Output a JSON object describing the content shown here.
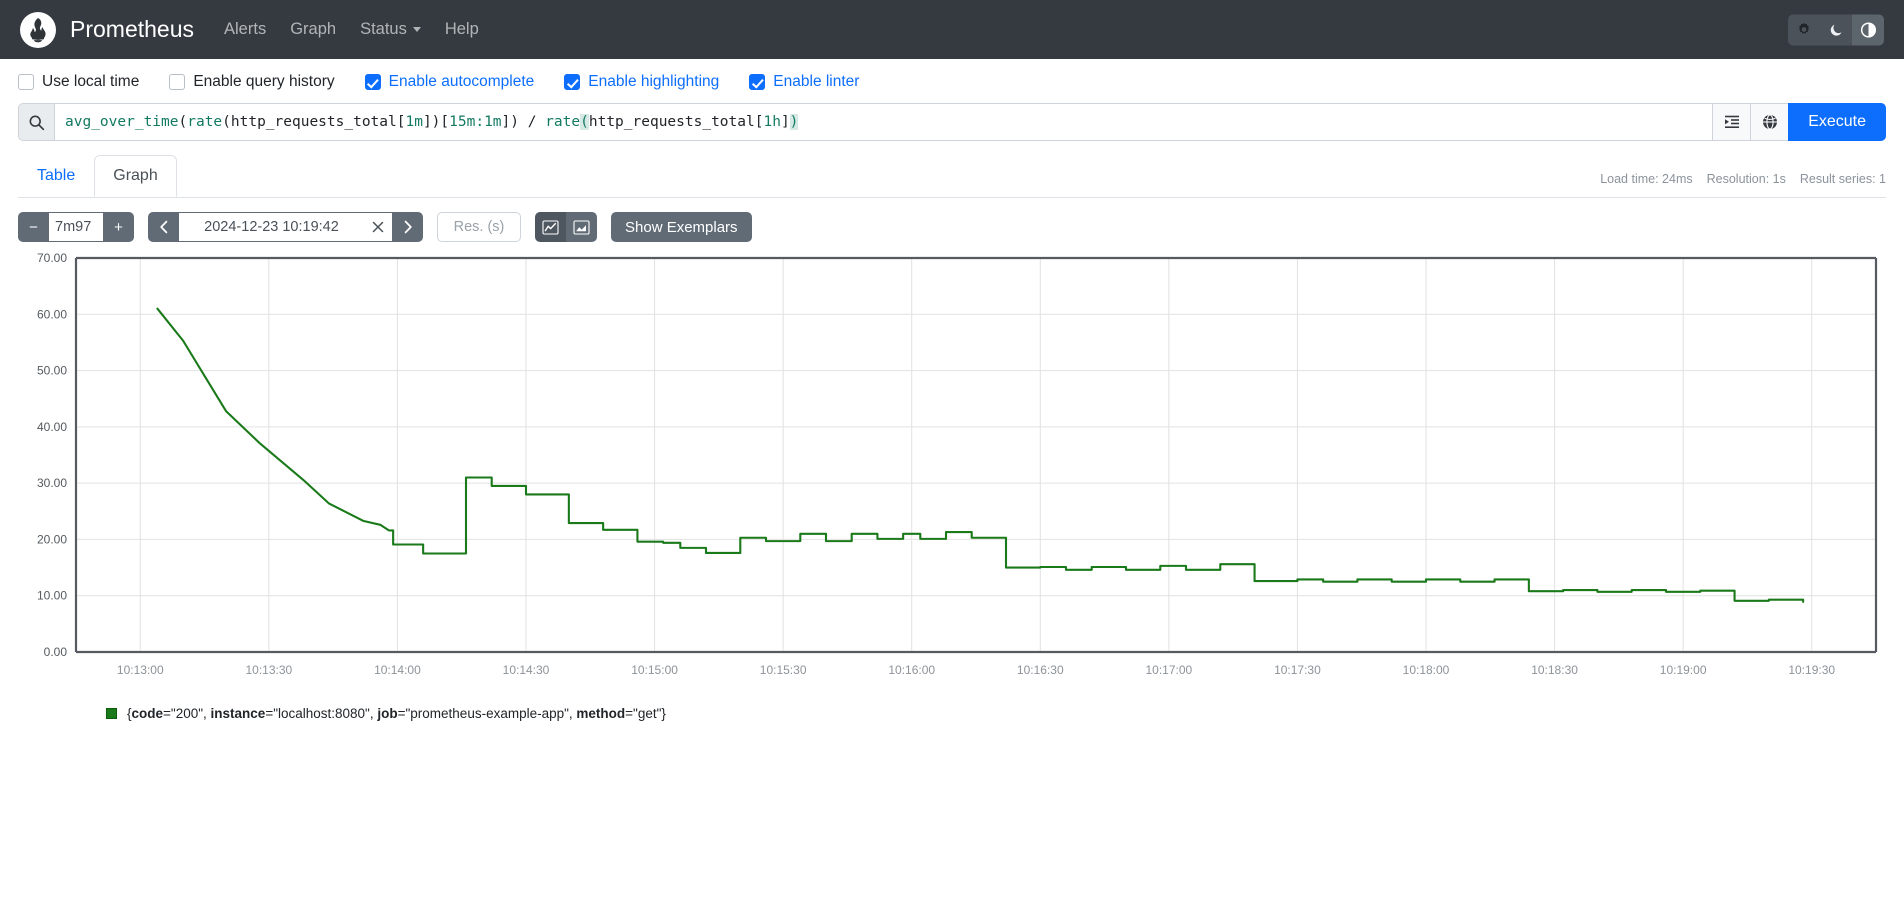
{
  "navbar": {
    "brand": "Prometheus",
    "logo_icon": "prometheus-torch-icon",
    "links": [
      {
        "label": "Alerts",
        "icon": ""
      },
      {
        "label": "Graph",
        "icon": ""
      },
      {
        "label": "Status",
        "icon": "chevron-down-icon",
        "has_caret": true
      },
      {
        "label": "Help",
        "icon": ""
      }
    ],
    "theme_buttons": [
      {
        "name": "light-theme-button",
        "icon": "sun-icon",
        "active": false
      },
      {
        "name": "dark-theme-button",
        "icon": "moon-icon",
        "active": false
      },
      {
        "name": "auto-theme-button",
        "icon": "half-circle-icon",
        "active": true
      }
    ]
  },
  "options": [
    {
      "label": "Use local time",
      "checked": false,
      "name": "use-local-time"
    },
    {
      "label": "Enable query history",
      "checked": false,
      "name": "enable-query-history"
    },
    {
      "label": "Enable autocomplete",
      "checked": true,
      "name": "enable-autocomplete"
    },
    {
      "label": "Enable highlighting",
      "checked": true,
      "name": "enable-highlighting"
    },
    {
      "label": "Enable linter",
      "checked": true,
      "name": "enable-linter"
    }
  ],
  "query": {
    "search_icon": "search-icon",
    "expression": "avg_over_time(rate(http_requests_total[1m])[15m:1m]) / rate(http_requests_total[1h])",
    "tokens": [
      {
        "text": "avg_over_time",
        "style": "fn"
      },
      {
        "text": "(",
        "style": "plain"
      },
      {
        "text": "rate",
        "style": "fn"
      },
      {
        "text": "(http_requests_total[",
        "style": "plain"
      },
      {
        "text": "1m",
        "style": "dur"
      },
      {
        "text": "])[",
        "style": "plain"
      },
      {
        "text": "15m:1m",
        "style": "dur"
      },
      {
        "text": "]) / ",
        "style": "plain"
      },
      {
        "text": "rate",
        "style": "fn"
      },
      {
        "text": "(",
        "style": "match"
      },
      {
        "text": "http_requests_total[",
        "style": "plain"
      },
      {
        "text": "1h",
        "style": "dur"
      },
      {
        "text": "]",
        "style": "plain"
      },
      {
        "text": ")",
        "style": "match"
      }
    ],
    "format_icon": "format-expression-icon",
    "metrics_explorer_icon": "globe-icon",
    "execute_label": "Execute"
  },
  "tabs": [
    {
      "label": "Table",
      "active": false,
      "name": "tab-table"
    },
    {
      "label": "Graph",
      "active": true,
      "name": "tab-graph"
    }
  ],
  "meta": {
    "load_time": "Load time: 24ms",
    "resolution": "Resolution: 1s",
    "result_series": "Result series: 1"
  },
  "controls": {
    "range_decrease": "−",
    "range_value": "7m97",
    "range_increase": "+",
    "time_prev": "‹",
    "time_value": "2024-12-23 10:19:42",
    "time_clear": "✕",
    "time_next": "›",
    "resolution_placeholder": "Res. (s)",
    "resolution_value": "",
    "chart_type_line_icon": "line-chart-icon",
    "chart_type_stacked_icon": "area-chart-icon",
    "chart_type_selected": "line",
    "show_exemplars_label": "Show Exemplars"
  },
  "legend": {
    "color": "#1a7a1a",
    "series_label": "{code=\"200\", instance=\"localhost:8080\", job=\"prometheus-example-app\", method=\"get\"}",
    "parts": [
      {
        "text": "{",
        "bold": false
      },
      {
        "text": "code",
        "bold": true
      },
      {
        "text": "=\"200\", ",
        "bold": false
      },
      {
        "text": "instance",
        "bold": true
      },
      {
        "text": "=\"localhost:8080\", ",
        "bold": false
      },
      {
        "text": "job",
        "bold": true
      },
      {
        "text": "=\"prometheus-example-app\", ",
        "bold": false
      },
      {
        "text": "method",
        "bold": true
      },
      {
        "text": "=\"get\"}",
        "bold": false
      }
    ]
  },
  "chart_data": {
    "type": "line",
    "title": "",
    "xlabel": "",
    "ylabel": "",
    "ylim": [
      0,
      70
    ],
    "yticks": [
      "0.00",
      "10.00",
      "20.00",
      "30.00",
      "40.00",
      "50.00",
      "60.00",
      "70.00"
    ],
    "ytick_values": [
      0,
      10,
      20,
      30,
      40,
      50,
      60,
      70
    ],
    "xticks": [
      "10:13:00",
      "10:13:30",
      "10:14:00",
      "10:14:30",
      "10:15:00",
      "10:15:30",
      "10:16:00",
      "10:16:30",
      "10:17:00",
      "10:17:30",
      "10:18:00",
      "10:18:30",
      "10:19:00",
      "10:19:30"
    ],
    "xtick_seconds": [
      780,
      810,
      840,
      870,
      900,
      930,
      960,
      990,
      1020,
      1050,
      1080,
      1110,
      1140,
      1170
    ],
    "xlim_seconds": [
      765,
      1185
    ],
    "grid": true,
    "legend_position": "bottom-left",
    "line_color": "#1a7a1a",
    "series": [
      {
        "name": "{code=\"200\", instance=\"localhost:8080\", job=\"prometheus-example-app\", method=\"get\"}",
        "x": [
          784,
          790,
          790,
          800,
          800,
          808,
          808,
          818,
          818,
          824,
          824,
          832,
          832,
          836,
          836,
          838,
          839,
          839,
          846,
          846,
          856,
          856,
          862,
          862,
          870,
          870,
          880,
          880,
          888,
          888,
          896,
          896,
          902,
          902,
          906,
          906,
          912,
          912,
          920,
          920,
          926,
          926,
          934,
          934,
          940,
          940,
          946,
          946,
          952,
          952,
          958,
          958,
          962,
          962,
          968,
          968,
          974,
          974,
          982,
          982,
          990,
          990,
          996,
          996,
          1002,
          1002,
          1010,
          1010,
          1018,
          1018,
          1024,
          1024,
          1032,
          1032,
          1040,
          1040,
          1050,
          1050,
          1056,
          1056,
          1064,
          1064,
          1072,
          1072,
          1080,
          1080,
          1088,
          1088,
          1096,
          1096,
          1104,
          1104,
          1112,
          1112,
          1120,
          1120,
          1128,
          1128,
          1136,
          1136,
          1144,
          1144,
          1152,
          1152,
          1160,
          1160,
          1168,
          1168,
          1176
        ],
        "y": [
          61.0,
          55.3,
          55.3,
          42.8,
          42.8,
          37.0,
          37.0,
          30.6,
          30.6,
          26.4,
          26.4,
          23.3,
          23.3,
          22.6,
          22.6,
          21.6,
          21.6,
          19.1,
          19.1,
          17.5,
          17.5,
          31.0,
          31.0,
          29.5,
          29.5,
          28.0,
          28.0,
          22.9,
          22.9,
          21.7,
          21.7,
          19.6,
          19.6,
          19.4,
          19.4,
          18.5,
          18.5,
          17.6,
          17.6,
          20.3,
          20.3,
          19.7,
          19.7,
          21.0,
          21.0,
          19.7,
          19.7,
          21.0,
          21.0,
          20.1,
          20.1,
          21.0,
          21.0,
          20.1,
          20.1,
          21.3,
          21.3,
          20.3,
          20.3,
          15.0,
          15.0,
          15.1,
          15.1,
          14.6,
          14.6,
          15.1,
          15.1,
          14.6,
          14.6,
          15.3,
          15.3,
          14.6,
          14.6,
          15.6,
          15.6,
          12.6,
          12.6,
          12.9,
          12.9,
          12.5,
          12.5,
          12.9,
          12.9,
          12.5,
          12.5,
          12.9,
          12.9,
          12.5,
          12.5,
          12.9,
          12.9,
          10.8,
          10.8,
          11.0,
          11.0,
          10.7,
          10.7,
          11.0,
          11.0,
          10.7,
          10.7,
          10.9,
          10.9,
          9.1,
          9.1,
          9.3,
          9.3,
          8.9
        ]
      }
    ]
  }
}
